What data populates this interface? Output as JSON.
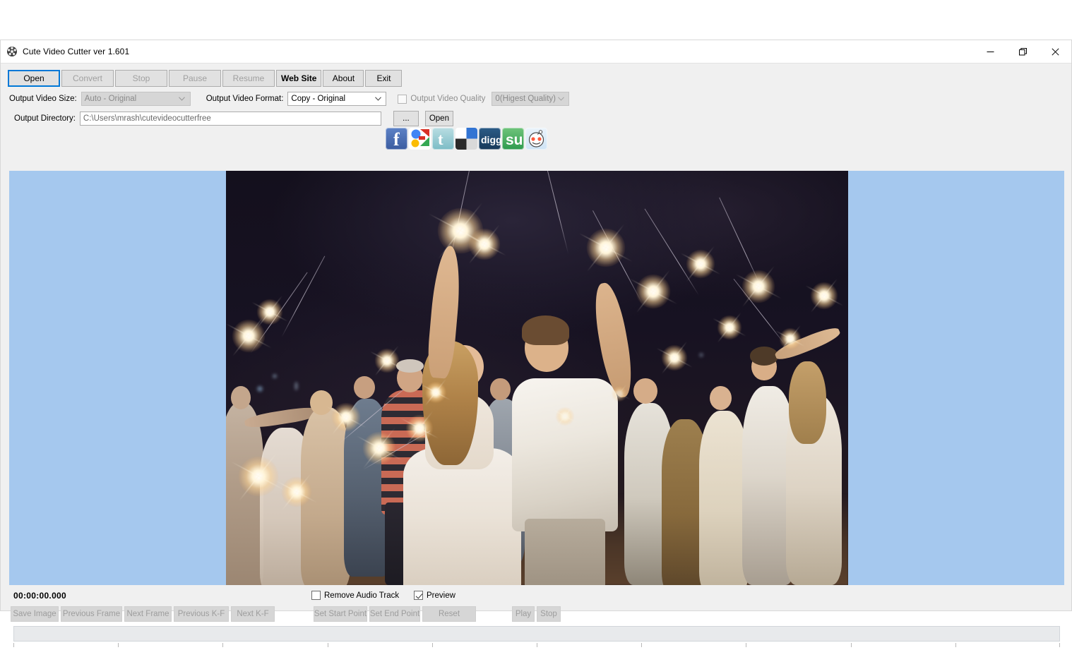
{
  "window": {
    "title": "Cute Video Cutter ver 1.601",
    "app_icon": "film-reel-icon",
    "minimize_label": "Minimize",
    "maximize_label": "Restore",
    "close_label": "Close"
  },
  "toolbar": {
    "buttons": [
      {
        "label": "Open",
        "state": "focused"
      },
      {
        "label": "Convert",
        "state": "disabled"
      },
      {
        "label": "Stop",
        "state": "disabled"
      },
      {
        "label": "Pause",
        "state": "disabled"
      },
      {
        "label": "Resume",
        "state": "disabled"
      },
      {
        "label": "Web Site",
        "state": "bold"
      },
      {
        "label": "About",
        "state": "normal"
      },
      {
        "label": "Exit",
        "state": "normal"
      }
    ],
    "social": [
      {
        "name": "facebook-icon",
        "label": "Facebook"
      },
      {
        "name": "google-icon",
        "label": "Google"
      },
      {
        "name": "twitter-icon",
        "label": "Twitter"
      },
      {
        "name": "delicious-icon",
        "label": "Delicious"
      },
      {
        "name": "digg-icon",
        "label": "Digg"
      },
      {
        "name": "stumbleupon-icon",
        "label": "StumbleUpon"
      },
      {
        "name": "reddit-icon",
        "label": "Reddit"
      }
    ]
  },
  "settings": {
    "video_size_label": "Output Video Size:",
    "video_size_value": "Auto - Original",
    "video_format_label": "Output Video Format:",
    "video_format_value": "Copy - Original",
    "video_quality_label": "Output Video Quality",
    "video_quality_checked": false,
    "video_quality_value": "0(Higest Quality)",
    "directory_label": "Output Directory:",
    "directory_value": "C:\\Users\\mrash\\cutevideocutterfree",
    "directory_placeholder": "C:\\Users\\mrash\\cutevideocutterfree",
    "browse_label": "...",
    "open_label": "Open"
  },
  "player": {
    "timecode": "00:00:00.000",
    "remove_audio_label": "Remove Audio Track",
    "remove_audio_checked": false,
    "preview_label": "Preview",
    "preview_checked": true,
    "controls": [
      {
        "label": "Save Image"
      },
      {
        "label": "Previous Frame"
      },
      {
        "label": "Next Frame"
      },
      {
        "label": "Previous K-F"
      },
      {
        "label": "Next K-F"
      },
      {
        "label": "Set  Start Point"
      },
      {
        "label": "Set  End Point"
      },
      {
        "label": "Reset"
      },
      {
        "label": "Play"
      },
      {
        "label": "Stop"
      }
    ]
  },
  "colors": {
    "preview_backdrop": "#a5c8ee",
    "chrome": "#f0f0f0",
    "accent": "#0078d7"
  }
}
